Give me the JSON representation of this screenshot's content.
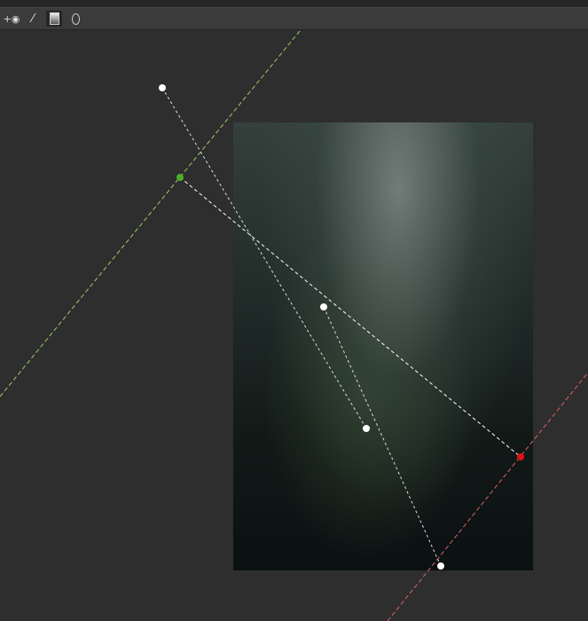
{
  "toolbar": {
    "tools": [
      {
        "icon": "add-eye-icon",
        "glyph": "+👁"
      },
      {
        "icon": "brush-icon",
        "glyph": "🖌"
      },
      {
        "icon": "gradient-icon",
        "glyph": "▯",
        "active": true
      },
      {
        "icon": "radial-icon",
        "glyph": "0"
      }
    ]
  },
  "overlay": {
    "start_line_color": "#9acd6a",
    "end_line_color": "#e05555",
    "start_handle_color": "#4caf2a",
    "end_handle_color": "#e01010",
    "guide_color": "#ffffff"
  }
}
